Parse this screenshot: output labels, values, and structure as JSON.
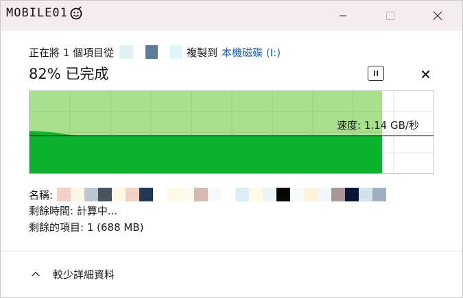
{
  "window": {
    "logo_text": "MOBILE01",
    "min_icon": "minimize-icon",
    "max_icon": "maximize-icon",
    "close_icon": "close-icon"
  },
  "progress": {
    "line_prefix": "正在將 1 個項目從",
    "line_middle": "複製到",
    "destination": "本機磁碟 (I:)",
    "percent_text": "82% 已完成",
    "percent_value": 82,
    "pause_icon": "pause-icon",
    "cancel_icon": "cancel-icon"
  },
  "graph": {
    "speed_label": "速度: 1.14 GB/秒",
    "fill_fraction": 0.87
  },
  "details": {
    "name_label": "名稱:",
    "time_label": "剩餘時間: 計算中...",
    "items_label": "剩餘的項目: 1 (688 MB)"
  },
  "footer": {
    "chevron_icon": "chevron-up-icon",
    "toggle_label": "較少詳細資料"
  },
  "colors": {
    "titlebar": "#f5ecef",
    "graph_light": "#a8e08f",
    "graph_dark": "#0bb22b",
    "link": "#1b62a8",
    "source_redaction": [
      "#e2f1f6",
      "#5e7d9a",
      "#dff4fb"
    ],
    "name_redaction": [
      "#f5d0cb",
      "#fdf5e6",
      "#b9c8d4",
      "#47535d",
      "#fef8e7",
      "#f1d2c4",
      "#213753",
      "#ffffff",
      "#fefae8",
      "#fbfcee",
      "#d7b9b4",
      "#f5fbfd",
      "#ffffff",
      "#ddeef6",
      "#fefbe9",
      "#ecf4f8",
      "#050505",
      "#f7fbfc",
      "#fff4d9",
      "#f1f8fb",
      "#a79797",
      "#0b1633",
      "#d2e3ec",
      "#9eafc2"
    ]
  }
}
